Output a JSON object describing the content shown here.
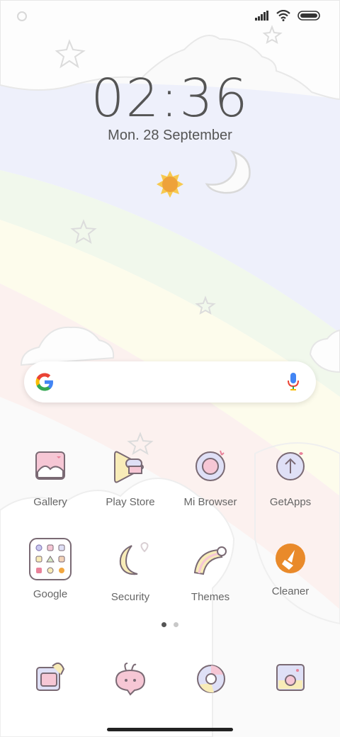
{
  "status_bar": {
    "signal_icon": "signal-icon",
    "wifi_icon": "wifi-icon",
    "battery_icon": "battery-icon"
  },
  "lock": {
    "time": "02:36",
    "date": "Mon. 28 September"
  },
  "search": {
    "google_icon": "google-g-icon",
    "mic_icon": "mic-icon"
  },
  "apps": [
    {
      "label": "Gallery",
      "icon": "gallery-icon"
    },
    {
      "label": "Play Store",
      "icon": "play-store-icon"
    },
    {
      "label": "Mi Browser",
      "icon": "mi-browser-icon"
    },
    {
      "label": "GetApps",
      "icon": "getapps-icon"
    },
    {
      "label": "Google",
      "icon": "google-folder-icon"
    },
    {
      "label": "Security",
      "icon": "security-icon"
    },
    {
      "label": "Themes",
      "icon": "themes-icon"
    },
    {
      "label": "Cleaner",
      "icon": "cleaner-icon"
    }
  ],
  "pager": {
    "pages": 2,
    "active": 1
  },
  "dock": [
    {
      "icon": "phone-icon"
    },
    {
      "icon": "messages-icon"
    },
    {
      "icon": "chrome-icon"
    },
    {
      "icon": "camera-icon"
    }
  ],
  "colors": {
    "text": "#555555",
    "label": "#666666",
    "cleaner_orange": "#e98a2a",
    "icon_stroke": "#7a6a74",
    "pastel_pink": "#f6c7cf",
    "pastel_yellow": "#f8efb8",
    "pastel_blue": "#dfe0f6"
  }
}
